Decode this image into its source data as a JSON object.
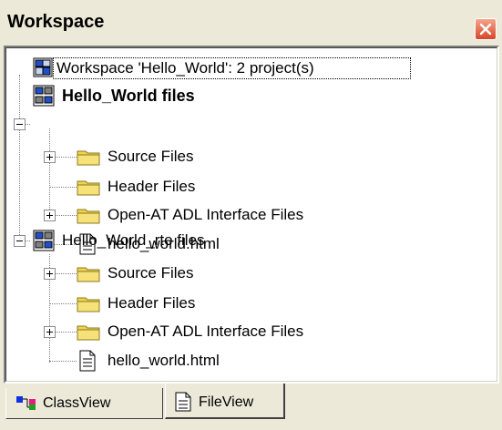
{
  "window": {
    "title": "Workspace"
  },
  "tree": {
    "root_label": "Workspace 'Hello_World': 2 project(s)",
    "projects": [
      {
        "label": "Hello_World files",
        "active": true,
        "items": [
          {
            "label": "Source Files",
            "type": "folder",
            "expandable": true
          },
          {
            "label": "Header Files",
            "type": "folder",
            "expandable": false
          },
          {
            "label": "Open-AT ADL Interface Files",
            "type": "folder",
            "expandable": true
          },
          {
            "label": "hello_world.html",
            "type": "file",
            "expandable": false
          }
        ]
      },
      {
        "label": "Hello_World_rte files",
        "active": false,
        "items": [
          {
            "label": "Source Files",
            "type": "folder",
            "expandable": true
          },
          {
            "label": "Header Files",
            "type": "folder",
            "expandable": false
          },
          {
            "label": "Open-AT ADL Interface Files",
            "type": "folder",
            "expandable": true
          },
          {
            "label": "hello_world.html",
            "type": "file",
            "expandable": false
          }
        ]
      }
    ]
  },
  "tabs": [
    {
      "label": "ClassView",
      "icon": "classview-icon",
      "selected": false
    },
    {
      "label": "FileView",
      "icon": "fileview-icon",
      "selected": true
    }
  ],
  "colors": {
    "close_button": "#d8452a",
    "folder": "#f2d34c",
    "window_bg": "#ece9d8"
  }
}
